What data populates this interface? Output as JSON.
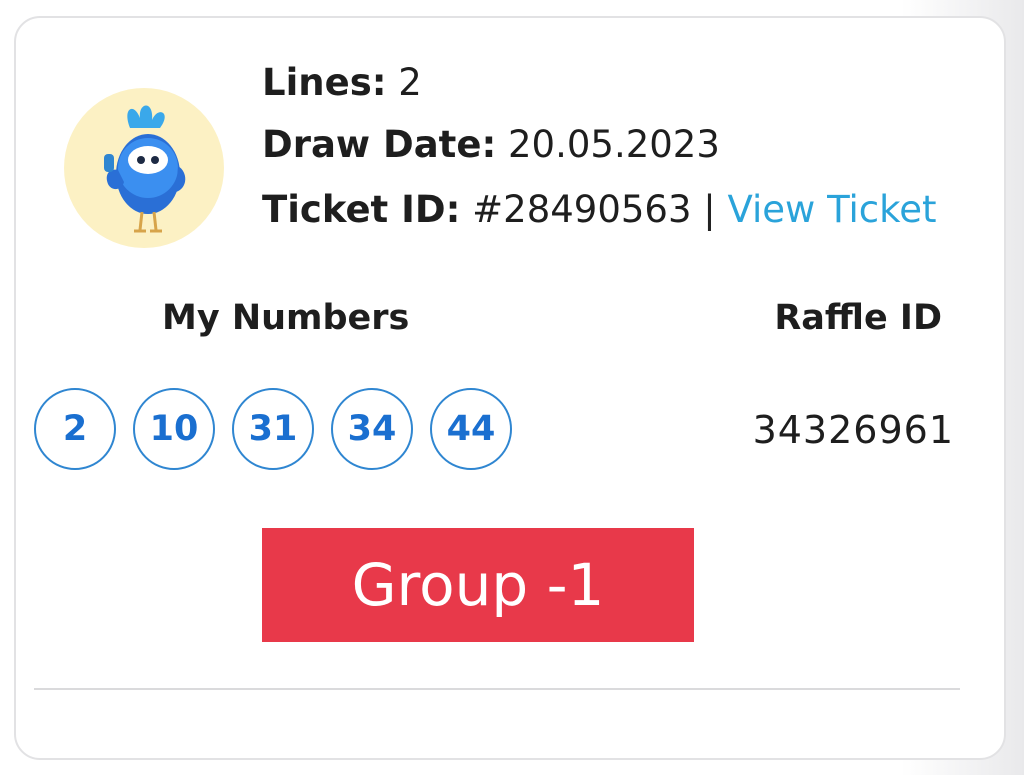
{
  "ticket": {
    "lines_label": "Lines:",
    "lines_value": "2",
    "draw_date_label": "Draw Date:",
    "draw_date_value": "20.05.2023",
    "ticket_id_label": "Ticket ID:",
    "ticket_id_value": "#28490563",
    "separator": "|",
    "view_ticket_link": "View Ticket"
  },
  "columns": {
    "my_numbers": "My Numbers",
    "raffle_id": "Raffle ID"
  },
  "numbers": [
    "2",
    "10",
    "31",
    "34",
    "44"
  ],
  "raffle_id_value": "34326961",
  "group_label": "Group -1",
  "icons": {
    "avatar": "mascot-bird-thumbs-up-icon"
  },
  "colors": {
    "ball_border": "#2f86d1",
    "ball_text": "#1a6fd0",
    "link": "#2aa3da",
    "group_banner": "#e8394a",
    "avatar_bg": "#fcf1c4"
  }
}
